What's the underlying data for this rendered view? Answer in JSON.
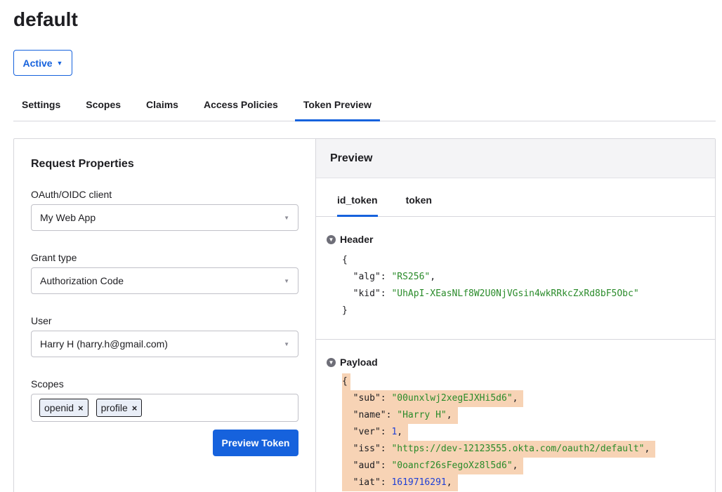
{
  "page": {
    "title": "default"
  },
  "status": {
    "label": "Active",
    "caret": "▼"
  },
  "tabs": [
    {
      "label": "Settings"
    },
    {
      "label": "Scopes"
    },
    {
      "label": "Claims"
    },
    {
      "label": "Access Policies"
    },
    {
      "label": "Token Preview",
      "active": true
    }
  ],
  "request": {
    "title": "Request Properties",
    "client": {
      "label": "OAuth/OIDC client",
      "value": "My Web App"
    },
    "grant": {
      "label": "Grant type",
      "value": "Authorization Code"
    },
    "user": {
      "label": "User",
      "value": "Harry H (harry.h@gmail.com)"
    },
    "scopes": {
      "label": "Scopes",
      "chips": [
        "openid",
        "profile"
      ],
      "remove_glyph": "×"
    },
    "button_label": "Preview Token"
  },
  "preview": {
    "title": "Preview",
    "subtabs": [
      "id_token",
      "token"
    ],
    "header": {
      "title": "Header",
      "open": "{",
      "close": "}",
      "alg_key": "\"alg\"",
      "alg_val": "\"RS256\"",
      "kid_key": "\"kid\"",
      "kid_val": "\"UhApI-XEasNLf8W2U0NjVGsin4wkRRkcZxRd8bF5Obc\""
    },
    "payload": {
      "title": "Payload",
      "open": "{",
      "sub_key": "\"sub\"",
      "sub_val": "\"00unxlwj2xegEJXHi5d6\"",
      "name_key": "\"name\"",
      "name_val": "\"Harry H\"",
      "ver_key": "\"ver\"",
      "ver_val": "1",
      "iss_key": "\"iss\"",
      "iss_val": "\"https://dev-12123555.okta.com/oauth2/default\"",
      "aud_key": "\"aud\"",
      "aud_val": "\"0oancf26sFegoXz8l5d6\"",
      "iat_key": "\"iat\"",
      "iat_val": "1619716291"
    }
  },
  "colors": {
    "accent": "#1662dd",
    "string": "#2a8b2a",
    "number": "#1e3fd6",
    "highlight": "#f7d3b5"
  }
}
